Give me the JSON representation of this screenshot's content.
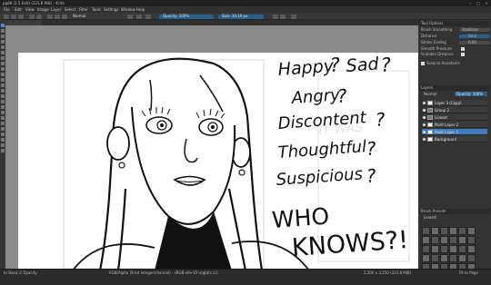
{
  "window": {
    "title": "pg88 (2.5 Edit) (223.8 MiB) - Krita"
  },
  "menu": [
    "File",
    "Edit",
    "View",
    "Image",
    "Layer",
    "Select",
    "Filter",
    "Tools",
    "Settings",
    "Window",
    "Help"
  ],
  "toolbar": {
    "blend_mode": "Normal",
    "opacity_label": "Opacity: 100%",
    "size_label": "Size: 19.19 px"
  },
  "canvas_text": {
    "line1_a": "Happy",
    "q1": "?",
    "line1_b": "Sad",
    "q2": "?",
    "line2": "Angry",
    "q3": "?",
    "line3": "Discontent",
    "q4": "?",
    "line4": "Thoughtful",
    "q5": "?",
    "line5": "Suspicious",
    "q6": "?",
    "who": "WHO",
    "knows": "KNOWS?!",
    "ghost": "IT WAS"
  },
  "docker": {
    "tool_options": {
      "title": "Tool Options",
      "rows": [
        {
          "label": "Brush Smoothing",
          "value": "Stabilizer"
        },
        {
          "label": "Distance",
          "value": "50.0"
        },
        {
          "label": "Stroke Ending",
          "value": "0.00"
        },
        {
          "label": "Smooth Pressure",
          "value": ""
        },
        {
          "label": "Scalable Distance",
          "value": ""
        },
        {
          "label": "Snap to Assistants",
          "value": ""
        }
      ]
    },
    "layers": {
      "title": "Layers",
      "blend": "Normal",
      "opacity": "Opacity: 100%",
      "items": [
        {
          "name": "Layer 3 (Copy)"
        },
        {
          "name": "Group 2"
        },
        {
          "name": "Lineart"
        },
        {
          "name": "Paint Layer 2"
        },
        {
          "name": "Paint Layer 1"
        },
        {
          "name": "Background"
        }
      ],
      "selected_index": 4
    },
    "presets": {
      "title": "Brush Presets",
      "tag": "Lineart"
    }
  },
  "status": {
    "left": "b) Basic-2 Opacity",
    "center": "RGB/Alpha (8-bit integer/channel) - sRGB-elle-V2-srgbtrc.icc",
    "right": "2,500 x 3,250 (223.8 MiB)",
    "zoom": "Fit to Page"
  },
  "colors": {
    "accent": "#3f7ab8",
    "ui_bg": "#333333",
    "canvas_bg": "#8a8a8a"
  }
}
